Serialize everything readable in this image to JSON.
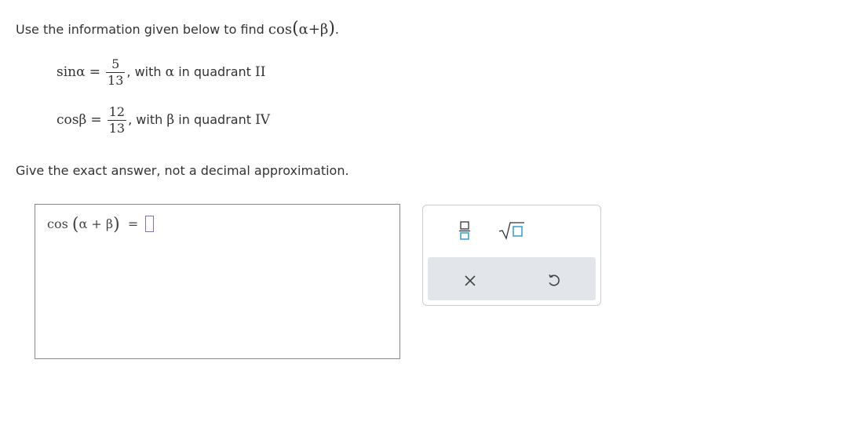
{
  "prompt": {
    "text": "Use the information given below to find",
    "fn": "cos",
    "expr_inner": "α+β",
    "end": "."
  },
  "given": [
    {
      "fn": "sin",
      "var": "α",
      "eq": "=",
      "numerator": "5",
      "denominator": "13",
      "comma": ",",
      "with_text": "with",
      "var2": "α",
      "in_text": "in quadrant",
      "quadrant": "II"
    },
    {
      "fn": "cos",
      "var": "β",
      "eq": "=",
      "numerator": "12",
      "denominator": "13",
      "comma": ",",
      "with_text": "with",
      "var2": "β",
      "in_text": "in quadrant",
      "quadrant": "IV"
    }
  ],
  "instruction": "Give the exact answer, not a decimal approximation.",
  "answer": {
    "fn": "cos",
    "inner": "α + β",
    "eq": "="
  },
  "toolbox": {
    "tools": [
      "fraction-icon",
      "square-root-icon"
    ],
    "actions": [
      "clear-icon",
      "undo-icon"
    ],
    "accent": "#2e9ed9"
  }
}
